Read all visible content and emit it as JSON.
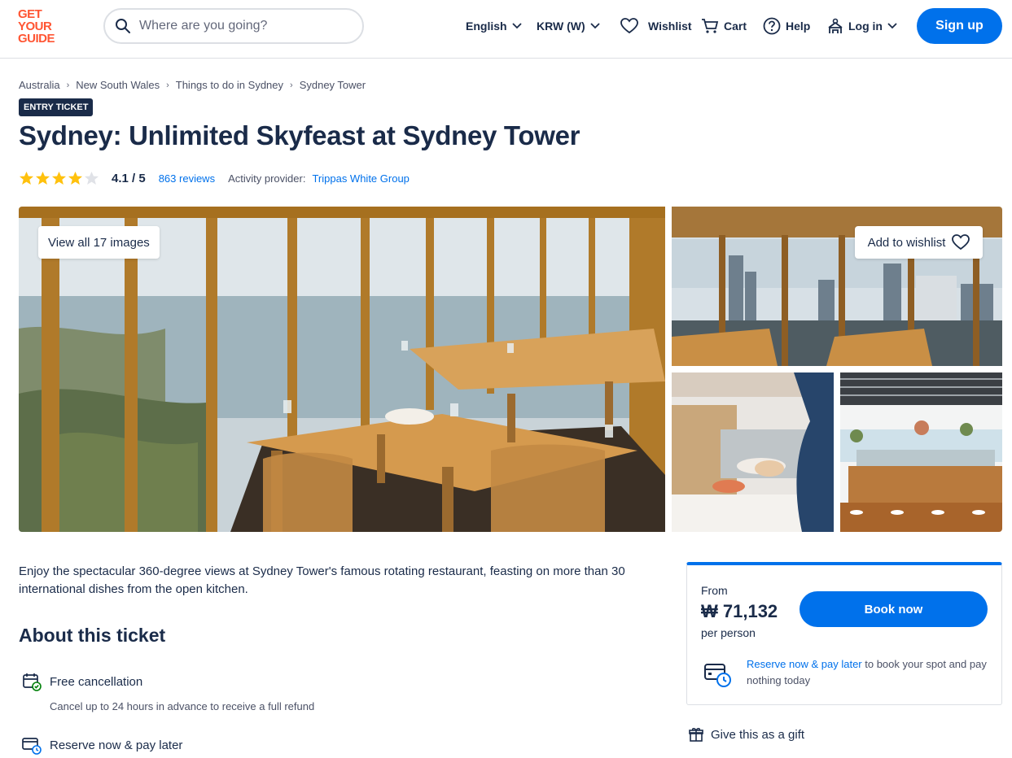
{
  "header": {
    "logo_lines": [
      "GET",
      "YOUR",
      "GUIDE"
    ],
    "search_placeholder": "Where are you going?",
    "language": "English",
    "currency": "KRW (W)",
    "wishlist": "Wishlist",
    "cart": "Cart",
    "help": "Help",
    "login": "Log in",
    "signup": "Sign up"
  },
  "breadcrumb": [
    "Australia",
    "New South Wales",
    "Things to do in Sydney",
    "Sydney Tower"
  ],
  "badge": "ENTRY TICKET",
  "title": "Sydney: Unlimited Skyfeast at Sydney Tower",
  "rating": {
    "stars": 4.1,
    "value": "4.1 / 5",
    "reviews": "863 reviews",
    "provider_label": "Activity provider:",
    "provider": "Trippas White Group"
  },
  "gallery": {
    "view_all": "View all 17 images",
    "add_to_wishlist": "Add to wishlist"
  },
  "description": "Enjoy the spectacular 360-degree views at Sydney Tower's famous rotating restaurant, feasting on more than 30 international dishes from the open kitchen.",
  "about": {
    "heading": "About this ticket",
    "features": [
      {
        "title": "Free cancellation",
        "subtitle": "Cancel up to 24 hours in advance to receive a full refund",
        "icon": "calendar-check-icon"
      },
      {
        "title": "Reserve now & pay later",
        "icon": "card-clock-icon"
      }
    ]
  },
  "booking": {
    "from": "From",
    "price": "₩ 71,132",
    "per_person": "per person",
    "book_now": "Book now",
    "reserve_link": "Reserve now & pay later",
    "reserve_rest": " to book your spot and pay nothing today"
  },
  "gift": "Give this as a gift",
  "colors": {
    "brand": "#ff5533",
    "primary": "#0071eb",
    "text": "#1a2b49",
    "star": "#ffc10d"
  }
}
